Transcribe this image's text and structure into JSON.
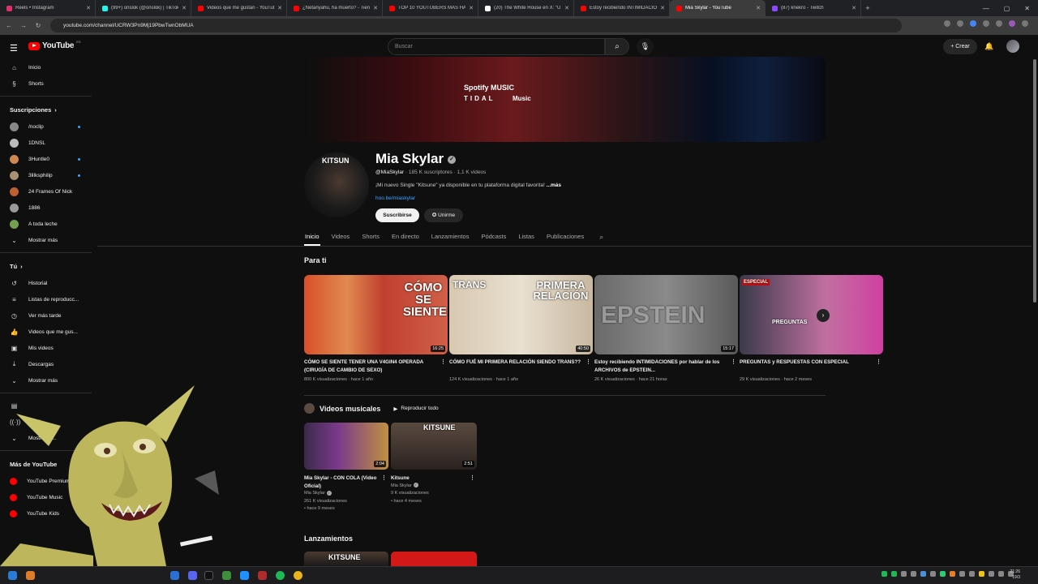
{
  "browser": {
    "tabs": [
      {
        "title": "Reels • Instagram",
        "color": "#e1306c"
      },
      {
        "title": "(99+) onslok (@onslok) | TikTok",
        "color": "#25f4ee"
      },
      {
        "title": "Videos que me gustan - YouTube",
        "color": "#ff0000"
      },
      {
        "title": "¿Netanyahu, ha muerto? - Tien",
        "color": "#ff0000"
      },
      {
        "title": "TOP 10 YOUTUBERS MÁS HAM",
        "color": "#ff0000"
      },
      {
        "title": "(20) The White House en X: \"U",
        "color": "#ffffff"
      },
      {
        "title": "Estoy recibiendo INTIMIDACIO",
        "color": "#ff0000"
      },
      {
        "title": "Mia Skylar - YouTube",
        "color": "#ff0000",
        "active": true
      },
      {
        "title": "(87) knekro - Twitch",
        "color": "#9146ff"
      }
    ],
    "close_glyph": "✕",
    "new_tab_glyph": "+",
    "url": "youtube.com/channel/UCRW3Pn9Mj19PbwTwnObMUA"
  },
  "header": {
    "logo_text": "YouTube",
    "logo_region": "ES",
    "search_placeholder": "Buscar",
    "create_label": "+ Crear"
  },
  "sidebar": {
    "top": [
      {
        "label": "Inicio",
        "icon": "home-icon",
        "glyph": "⌂"
      },
      {
        "label": "Shorts",
        "icon": "shorts-icon",
        "glyph": "§"
      }
    ],
    "subs_header": "Suscripciones",
    "subs": [
      {
        "label": "/noclip",
        "color": "#888888",
        "dot": true
      },
      {
        "label": "1DNSL",
        "color": "#bbbbbb",
        "dot": false
      },
      {
        "label": "3Huntle0",
        "color": "#d08850",
        "dot": true
      },
      {
        "label": "3lilksphilip",
        "color": "#a89070",
        "dot": true
      },
      {
        "label": "24 Frames Of Nick",
        "color": "#c06030",
        "dot": false
      },
      {
        "label": "1886",
        "color": "#999999",
        "dot": false
      },
      {
        "label": "A toda leche",
        "color": "#70a050",
        "dot": false
      }
    ],
    "subs_more": "Mostrar más",
    "you_header": "Tú",
    "you": [
      {
        "label": "Historial",
        "glyph": "↺"
      },
      {
        "label": "Listas de reproducc...",
        "glyph": "≡"
      },
      {
        "label": "Ver más tarde",
        "glyph": "◷"
      },
      {
        "label": "Videos que me gus...",
        "glyph": "👍"
      },
      {
        "label": "Mis videos",
        "glyph": "▣"
      },
      {
        "label": "Descargas",
        "glyph": "⤓"
      },
      {
        "label": "Mostrar más",
        "glyph": "⌄"
      }
    ],
    "explore_items": [
      {
        "label": "",
        "glyph": "▤"
      },
      {
        "label": "En di...",
        "glyph": "((·))"
      },
      {
        "label": "Mostrar m...",
        "glyph": "⌄"
      }
    ],
    "more_header": "Más de YouTube",
    "more": [
      {
        "label": "YouTube Premium"
      },
      {
        "label": "YouTube Music"
      },
      {
        "label": "YouTube Kids"
      }
    ]
  },
  "channel": {
    "banner_lines": [
      "Spotify   MUSIC",
      "TIDAL",
      "Music"
    ],
    "avatar_text": "KITSUN",
    "name": "Mia Skylar",
    "handle": "@MiaSkylar",
    "stats": " · 185 K suscriptores · 1,1 K videos",
    "desc": "¡Mi nuevo Single \"Kitsune\" ya disponible en tu plataforma digital favorita!",
    "desc_more": "...más",
    "link": "hoo.be/miaskylar",
    "subscribe": "Suscribirse",
    "join": "Unirme",
    "tabs": [
      "Inicio",
      "Videos",
      "Shorts",
      "En directo",
      "Lanzamientos",
      "Pódcasts",
      "Listas",
      "Publicaciones"
    ]
  },
  "para_ti": {
    "title": "Para ti",
    "videos": [
      {
        "title": "CÓMO SE SIENTE TENER UNA V4GIN4 OPERADA (CIRUGÍA DE CAMBIO DE SEXO)",
        "meta": "800 K visualizaciones · hace 1 año",
        "duration": "16:25",
        "thumb_text": "CÓMO SE SIENTE"
      },
      {
        "title": "CÓMO FUÉ MI PRIMERA RELACIÓN SIENDO TRANS??",
        "meta": "124 K visualizaciones · hace 1 año",
        "duration": "40:50",
        "thumb_text_a": "TRANS",
        "thumb_text_b": "PRIMERA RELACIÓN"
      },
      {
        "title": "Estoy recibiendo INTIMIDACIONES por hablar de los ARCHIVOS de EPSTEIN...",
        "meta": "26 K visualizaciones · hace 21 horas",
        "duration": "15:17",
        "thumb_text": "EPSTEIN"
      },
      {
        "title": "PREGUNTAS y RESPUESTAS CON ESPECIAL",
        "meta": "29 K visualizaciones · hace 2 meses",
        "duration": "",
        "thumb_text_a": "ESPECIAL",
        "thumb_text_b": "PREGUNTAS"
      }
    ]
  },
  "musicales": {
    "title": "Videos musicales",
    "play_all": "Reproducir todo",
    "videos": [
      {
        "title": "Mia Skylar - CON COLA (Video Oficial)",
        "channel": "Mia Skylar",
        "views": "261 K visualizaciones",
        "age": "• hace 9 meses",
        "duration": "2:04"
      },
      {
        "title": "Kitsune",
        "channel": "Mia Skylar",
        "views": "9 K visualizaciones",
        "age": "• hace 4 meses",
        "duration": "2:51",
        "thumb_text": "KITSUNE"
      }
    ]
  },
  "lanzamientos": {
    "title": "Lanzamientos",
    "thumb_text": "KITSUNE"
  },
  "taskbar": {
    "clock_time": "21:26",
    "clock_date": "19/3"
  }
}
